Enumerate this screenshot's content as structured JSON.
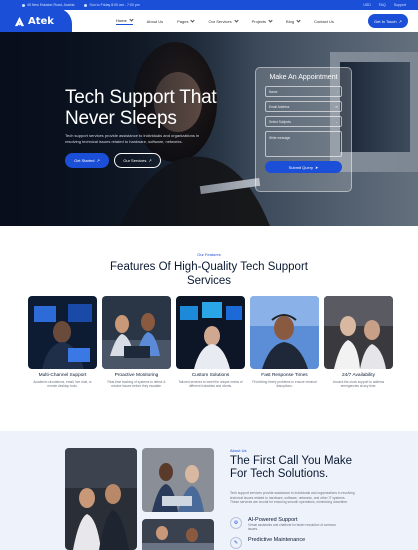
{
  "topbar": {
    "address": "45 New Eskaton Road, Austria",
    "hours": "Sun to Friday 8:00 am - 7:00 pm",
    "currency": "USD",
    "faq": "FAQ",
    "support": "Support"
  },
  "brand": {
    "name": "Atek"
  },
  "nav": {
    "items": [
      {
        "label": "Home",
        "has_caret": true
      },
      {
        "label": "About Us",
        "has_caret": false
      },
      {
        "label": "Pages",
        "has_caret": true
      },
      {
        "label": "Our Services",
        "has_caret": true
      },
      {
        "label": "Projects",
        "has_caret": true
      },
      {
        "label": "Blog",
        "has_caret": true
      },
      {
        "label": "Contact Us",
        "has_caret": false
      }
    ],
    "cta": "Get In Touch"
  },
  "hero": {
    "title": "Tech Support That Never Sleeps",
    "text": "Tech support services provide assistance to individuals and organizations in resolving technical issues related to hardware, software, networks.",
    "btn_start": "Get Started",
    "btn_services": "Our Services"
  },
  "appointment": {
    "title": "Make An Appointment",
    "name_placeholder": "Name",
    "email_placeholder": "Email Address",
    "subject_placeholder": "Select Subjects",
    "message_placeholder": "Write message",
    "submit": "Submit Query"
  },
  "features": {
    "eyebrow": "Our Features",
    "title": "Features Of High-Quality Tech Support Services",
    "cards": [
      {
        "title": "Multi-Channel Support",
        "desc": "Academic circulations, email, live chat, or remote desktop tools."
      },
      {
        "title": "Proactive Monitoring",
        "desc": "Real-time tracking of systems to detect & resolve issues before they escalate."
      },
      {
        "title": "Custom Solutions",
        "desc": "Tailored services to meet the unique needs of different industries and clients."
      },
      {
        "title": "Fast Response Times",
        "desc": "Prioritizing timely problems to ensure minimal disruptions."
      },
      {
        "title": "24/7 Availability",
        "desc": "Around-the-clock support to address emergencies at any time."
      }
    ]
  },
  "about": {
    "eyebrow": "About Us",
    "title": "The First Call You Make For Tech Solutions.",
    "text": "Tech support services provide assistance to individuals and organizations in resolving technical issues related to hardware, software, networks, and other IT systems. These services are crucial for ensuring smooth operations, minimizing downtime.",
    "features": [
      {
        "title": "AI-Powered Support",
        "desc": "Virtual assistants and chatbots for faster resolution of common issues."
      },
      {
        "title": "Predictive Maintenance",
        "desc": ""
      }
    ]
  },
  "colors": {
    "brand": "#1b4fd8",
    "navy": "#0b1a33",
    "about_bg": "#eef2fa"
  }
}
